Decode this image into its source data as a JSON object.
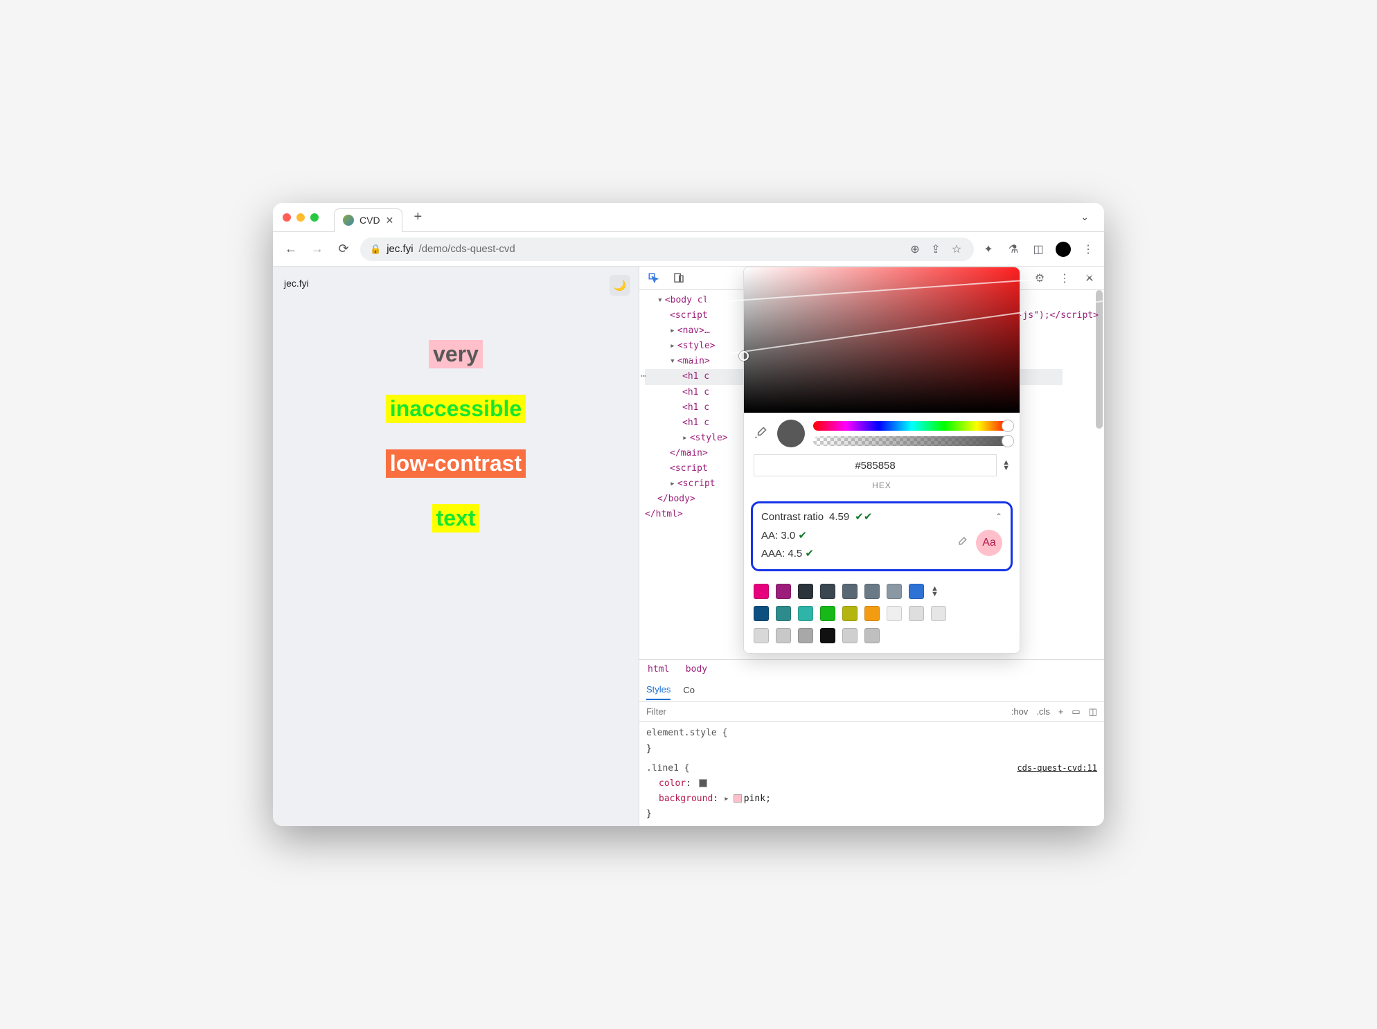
{
  "titlebar": {
    "tab_title": "CVD"
  },
  "urlbar": {
    "host": "jec.fyi",
    "path": "/demo/cds-quest-cvd"
  },
  "page": {
    "site_id": "jec.fyi",
    "lines": {
      "l1": "very",
      "l2": "inaccessible",
      "l3": "low-contrast",
      "l4": "text"
    }
  },
  "devtools": {
    "elements": {
      "body_open_frag": "<body cl",
      "script1_open": "<script",
      "script1_tail": "o-js\");</script>",
      "nav": "<nav>…",
      "style_tag": "<style>",
      "main_open": "<main>",
      "h1_frag": "<h1 c",
      "style_tag2": "<style>",
      "main_close": "</main>",
      "script2": "<script",
      "script3": "<script",
      "body_close": "</body>",
      "html_close": "</html>"
    },
    "crumbs": {
      "c1": "html",
      "c2": "body"
    },
    "styles_tabs": {
      "styles": "Styles",
      "computed_frag": "Co"
    },
    "filter_placeholder": "Filter",
    "filter_right": {
      "hov": ":hov",
      "cls": ".cls"
    },
    "css": {
      "elstyle": "element.style {",
      "sel": ".line1 {",
      "prop_color": "color",
      "prop_bg": "background",
      "val_bg": "pink",
      "src": "cds-quest-cvd:11"
    }
  },
  "picker": {
    "hex": "#585858",
    "hex_label": "HEX",
    "contrast": {
      "label": "Contrast ratio",
      "value": "4.59",
      "aa_label": "AA:",
      "aa_val": "3.0",
      "aaa_label": "AAA:",
      "aaa_val": "4.5",
      "sample": "Aa"
    },
    "palette": [
      "#e6007e",
      "#9b1f7a",
      "#2b333b",
      "#3a4650",
      "#586874",
      "#6a7a86",
      "#8a98a3",
      "#2f72d6",
      "#0d4f7f",
      "#2e8b8b",
      "#2fb4a8",
      "#18b818",
      "#b5b50f",
      "#f39c12",
      "#efefef",
      "#dedede",
      "#e6e6e6",
      "#d8d8d8",
      "#c8c8c8",
      "#a8a8a8",
      "#111111",
      "#cfcfcf",
      "#bfbfbf"
    ]
  }
}
